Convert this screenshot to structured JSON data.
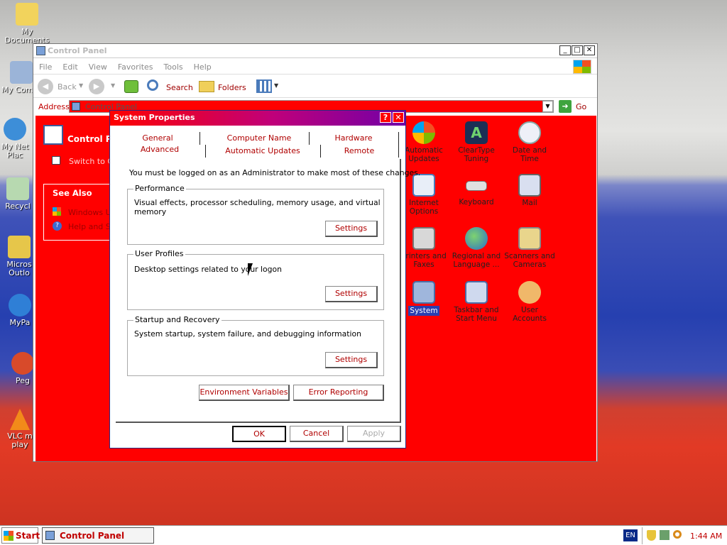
{
  "desktop": {
    "icons": [
      {
        "label": "My Documents"
      },
      {
        "label": "My Com"
      },
      {
        "label": "My Net Plac"
      },
      {
        "label": "Recycl"
      },
      {
        "label": "Micros Outlo"
      },
      {
        "label": "MyPa"
      },
      {
        "label": "Peg"
      },
      {
        "label": "VLC m play"
      }
    ]
  },
  "window": {
    "title": "Control Panel",
    "menu": [
      "File",
      "Edit",
      "View",
      "Favorites",
      "Tools",
      "Help"
    ],
    "toolbar": {
      "back": "Back",
      "search": "Search",
      "folders": "Folders"
    },
    "address": {
      "label": "Address",
      "value": "Control Panel",
      "go": "Go"
    },
    "sidebar": {
      "panel_title": "Control Pan",
      "switch_link": "Switch to Ca",
      "see_also": "See Also",
      "links": [
        "Windows Up",
        "Help and Sup"
      ]
    },
    "icons": [
      {
        "label": "Automatic Updates"
      },
      {
        "label": "ClearType Tuning"
      },
      {
        "label": "Date and Time"
      },
      {
        "label": "Internet Options"
      },
      {
        "label": "Keyboard"
      },
      {
        "label": "Mail"
      },
      {
        "label": "Printers and Faxes"
      },
      {
        "label": "Regional and Language ..."
      },
      {
        "label": "Scanners and Cameras"
      },
      {
        "label": "System"
      },
      {
        "label": "Taskbar and Start Menu"
      },
      {
        "label": "User Accounts"
      }
    ]
  },
  "dialog": {
    "title": "System Properties",
    "help_btn": "?",
    "close_btn": "✕",
    "tabs_row1": [
      "General",
      "Computer Name",
      "Hardware"
    ],
    "tabs_row2": [
      "Advanced",
      "Automatic Updates",
      "Remote"
    ],
    "notice": "You must be logged on as an Administrator to make most of these changes.",
    "groups": [
      {
        "title": "Performance",
        "desc": "Visual effects, processor scheduling, memory usage, and virtual memory",
        "button": "Settings"
      },
      {
        "title": "User Profiles",
        "desc": "Desktop settings related to your logon",
        "button": "Settings"
      },
      {
        "title": "Startup and Recovery",
        "desc": "System startup, system failure, and debugging information",
        "button": "Settings"
      }
    ],
    "env_button": "Environment Variables",
    "error_button": "Error Reporting",
    "ok": "OK",
    "cancel": "Cancel",
    "apply": "Apply"
  },
  "taskbar": {
    "start": "Start",
    "task": "Control Panel",
    "lang": "EN",
    "time": "1:44 AM"
  }
}
